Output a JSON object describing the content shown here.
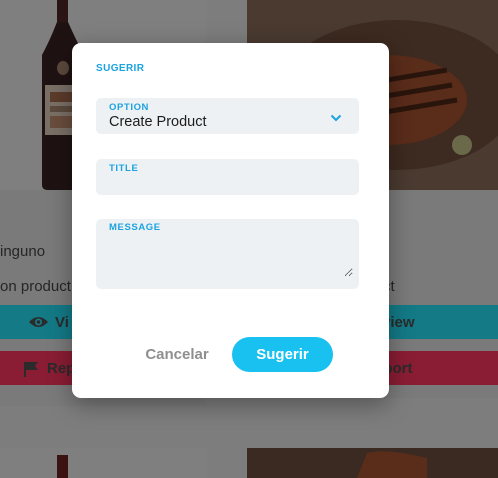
{
  "background_cards": {
    "left": {
      "name_partial": "inguno",
      "desc_partial": "on product",
      "view_label_partial": "Vi",
      "report_label_partial": "Rep"
    },
    "right": {
      "desc_partial": "ct",
      "view_label_partial": "view",
      "report_label_partial": "eport"
    }
  },
  "modal": {
    "title": "SUGERIR",
    "option": {
      "label": "OPTION",
      "selected": "Create Product"
    },
    "title_field": {
      "label": "TITLE",
      "value": ""
    },
    "message_field": {
      "label": "MESSAGE",
      "value": ""
    },
    "cancel_label": "Cancelar",
    "submit_label": "Sugerir"
  },
  "colors": {
    "accent": "#1aa3e0",
    "submit": "#18c1f0",
    "view_band": "#137a86",
    "report_band": "#8a1d34"
  }
}
